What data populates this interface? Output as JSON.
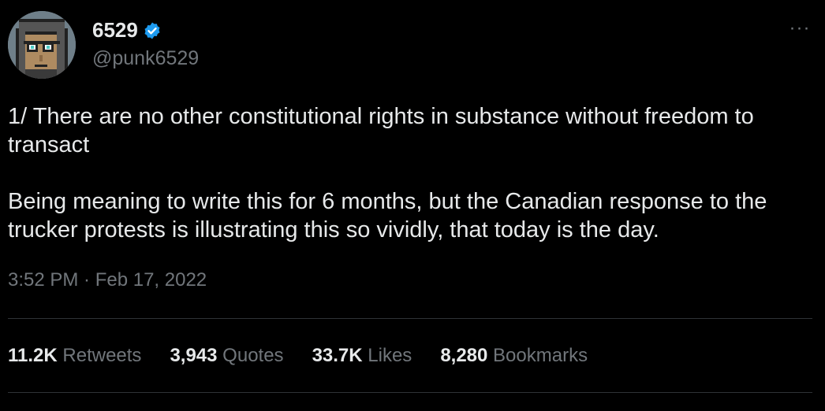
{
  "author": {
    "display_name": "6529",
    "handle": "@punk6529",
    "verified_icon": "verified-badge-icon",
    "avatar_icon": "cryptopunk-avatar"
  },
  "menu": {
    "more_label": "···"
  },
  "tweet": {
    "paragraphs": [
      "1/ There are no other constitutional rights in substance without freedom to transact",
      "Being meaning to write this for 6 months, but the Canadian response to the trucker protests is illustrating this so vividly, that today is the day."
    ],
    "timestamp": "3:52 PM · Feb 17, 2022"
  },
  "stats": [
    {
      "count": "11.2K",
      "label": "Retweets"
    },
    {
      "count": "3,943",
      "label": "Quotes"
    },
    {
      "count": "33.7K",
      "label": "Likes"
    },
    {
      "count": "8,280",
      "label": "Bookmarks"
    }
  ],
  "colors": {
    "background": "#000000",
    "text": "#e7e9ea",
    "secondary": "#71767b",
    "divider": "#2f3336",
    "verified": "#1d9bf0"
  }
}
